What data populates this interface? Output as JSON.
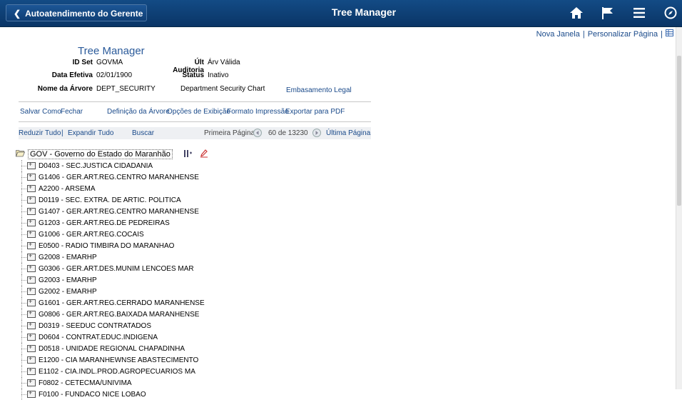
{
  "topbar": {
    "back_label": "Autoatendimento do Gerente",
    "title": "Tree Manager",
    "icons": [
      "home-icon",
      "flag-icon",
      "menu-icon",
      "navigate-icon"
    ]
  },
  "pagelinks": {
    "new_window": "Nova Janela",
    "separator": "|",
    "personalize": "Personalizar Página"
  },
  "header": {
    "title": "Tree Manager",
    "setid_label": "ID Set",
    "setid_value": "GOVMA",
    "audit_label": "Últ Auditoria",
    "audit_value": "Árv Válida",
    "effdate_label": "Data Efetiva",
    "effdate_value": "02/01/1900",
    "status_label": "Status",
    "status_value": "Inativo",
    "treename_label": "Nome da Árvore",
    "treename_value": "DEPT_SECURITY",
    "tree_desc": "Department Security Chart",
    "legal_link": "Embasamento Legal"
  },
  "actions": {
    "save_as": "Salvar Como",
    "close": "Fechar",
    "tree_def": "Definição da Árvore",
    "display_opts": "Opções de Exibição",
    "print_format": "Formato Impressão",
    "export_pdf": "Exportar para PDF"
  },
  "toolbar": {
    "collapse_all": "Reduzir Tudo",
    "sep": "|",
    "expand_all": "Expandir Tudo",
    "find": "Buscar",
    "first_page": "Primeira Página",
    "counter": "60 de 13230",
    "last_page": "Última Página"
  },
  "tree": {
    "root": "GOV - Governo do Estado do Maranhão",
    "nodes": [
      "D0403 - SEC.JUSTICA CIDADANIA",
      "G1406 - GER.ART.REG.CENTRO MARANHENSE",
      "A2200 - ARSEMA",
      "D0119 - SEC. EXTRA. DE ARTIC. POLITICA",
      "G1407 - GER.ART.REG.CENTRO MARANHENSE",
      "G1203 - GER.ART.REG.DE PEDREIRAS",
      "G1006 - GER.ART.REG.COCAIS",
      "E0500 - RADIO TIMBIRA DO MARANHAO",
      "G2008 - EMARHP",
      "G0306 - GER.ART.DES.MUNIM LENCOES MAR",
      "G2003 - EMARHP",
      "G2002 - EMARHP",
      "G1601 - GER.ART.REG.CERRADO MARANHENSE",
      "G0806 - GER.ART.REG.BAIXADA MARANHENSE",
      "D0319 - SEEDUC CONTRATADOS",
      "D0604 - CONTRAT.EDUC.INDIGENA",
      "D0518 - UNIDADE REGIONAL CHAPADINHA",
      "E1200 - CIA MARANHEWNSE ABASTECIMENTO",
      "E1102 - CIA.INDL.PROD.AGROPECUARIOS MA",
      "F0802 - CETECMA/UNIVIMA",
      "F0100 - FUNDACO NICE LOBAO"
    ]
  }
}
